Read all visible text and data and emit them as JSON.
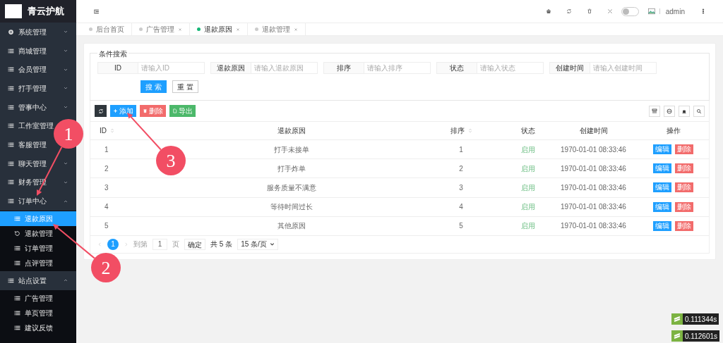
{
  "brand": {
    "title": "青云护航"
  },
  "sidebar": {
    "items": [
      {
        "label": "系统管理",
        "kind": "settings",
        "expandable": true,
        "expanded": false
      },
      {
        "label": "商城管理",
        "kind": "list",
        "expandable": true,
        "expanded": false
      },
      {
        "label": "会员管理",
        "kind": "list",
        "expandable": true,
        "expanded": false
      },
      {
        "label": "打手管理",
        "kind": "list",
        "expandable": true,
        "expanded": false
      },
      {
        "label": "管事中心",
        "kind": "list",
        "expandable": true,
        "expanded": false
      },
      {
        "label": "工作室管理",
        "kind": "list",
        "expandable": false
      },
      {
        "label": "客服管理",
        "kind": "list",
        "expandable": false
      },
      {
        "label": "聊天管理",
        "kind": "list",
        "expandable": true,
        "expanded": false
      },
      {
        "label": "财务管理",
        "kind": "list",
        "expandable": true,
        "expanded": false
      },
      {
        "label": "订单中心",
        "kind": "list",
        "expandable": true,
        "expanded": true,
        "children": [
          {
            "label": "退款原因",
            "kind": "list",
            "selected": true
          },
          {
            "label": "退款管理",
            "kind": "refresh",
            "selected": false
          },
          {
            "label": "订单管理",
            "kind": "list",
            "selected": false
          },
          {
            "label": "点评管理",
            "kind": "list",
            "selected": false
          }
        ]
      },
      {
        "label": "站点设置",
        "kind": "list",
        "expandable": true,
        "expanded": true,
        "children": [
          {
            "label": "广告管理",
            "kind": "list",
            "selected": false
          },
          {
            "label": "单页管理",
            "kind": "list",
            "selected": false
          },
          {
            "label": "建议反馈",
            "kind": "list",
            "selected": false
          }
        ]
      }
    ]
  },
  "header": {
    "theme_switch": {
      "on": false
    },
    "user": "admin"
  },
  "tabs": [
    {
      "label": "后台首页",
      "selected": false,
      "closable": false
    },
    {
      "label": "广告管理",
      "selected": false,
      "closable": true
    },
    {
      "label": "退款原因",
      "selected": true,
      "closable": true
    },
    {
      "label": "退款管理",
      "selected": false,
      "closable": true
    }
  ],
  "search": {
    "legend": "条件搜索",
    "fields": [
      {
        "label": "ID",
        "placeholder": "请输入ID"
      },
      {
        "label": "退款原因",
        "placeholder": "请输入退款原因"
      },
      {
        "label": "排序",
        "placeholder": "请输入排序"
      },
      {
        "label": "状态",
        "placeholder": "请输入状态"
      },
      {
        "label": "创建时间",
        "placeholder": "请输入创建时间"
      }
    ],
    "buttons": [
      {
        "label": "搜 索",
        "kind": "primary"
      },
      {
        "label": "重 置",
        "kind": "plain"
      }
    ]
  },
  "toolbar": {
    "buttons": [
      {
        "label": "添加",
        "kind": "add"
      },
      {
        "label": "删除",
        "kind": "delete"
      },
      {
        "label": "导出",
        "kind": "export"
      }
    ]
  },
  "table": {
    "columns": [
      {
        "label": "ID",
        "sortable": true
      },
      {
        "label": "退款原因",
        "sortable": false
      },
      {
        "label": "排序",
        "sortable": true
      },
      {
        "label": "状态",
        "sortable": false
      },
      {
        "label": "创建时间",
        "sortable": false
      },
      {
        "label": "操作",
        "sortable": false
      }
    ],
    "rows": [
      {
        "id": "1",
        "reason": "打手未接单",
        "sort": "1",
        "status": "启用",
        "enabled": true,
        "created": "1970-01-01 08:33:46",
        "actions": [
          "编辑",
          "删除"
        ]
      },
      {
        "id": "2",
        "reason": "打手炸单",
        "sort": "2",
        "status": "启用",
        "enabled": true,
        "created": "1970-01-01 08:33:46",
        "actions": [
          "编辑",
          "删除"
        ]
      },
      {
        "id": "3",
        "reason": "服务质量不满意",
        "sort": "3",
        "status": "启用",
        "enabled": true,
        "created": "1970-01-01 08:33:46",
        "actions": [
          "编辑",
          "删除"
        ]
      },
      {
        "id": "4",
        "reason": "等待时间过长",
        "sort": "4",
        "status": "启用",
        "enabled": true,
        "created": "1970-01-01 08:33:46",
        "actions": [
          "编辑",
          "删除"
        ]
      },
      {
        "id": "5",
        "reason": "其他原因",
        "sort": "5",
        "status": "启用",
        "enabled": true,
        "created": "1970-01-01 08:33:46",
        "actions": [
          "编辑",
          "删除"
        ]
      }
    ]
  },
  "pagination": {
    "current": "1",
    "goto_label": "到第",
    "page_input": "1",
    "page_label": "页",
    "confirm": "确定",
    "total": "共 5 条",
    "page_size": "15 条/页"
  },
  "timings": [
    "0.111344s",
    "0.112601s"
  ],
  "annotations": [
    {
      "label": "1"
    },
    {
      "label": "2"
    },
    {
      "label": "3"
    }
  ]
}
